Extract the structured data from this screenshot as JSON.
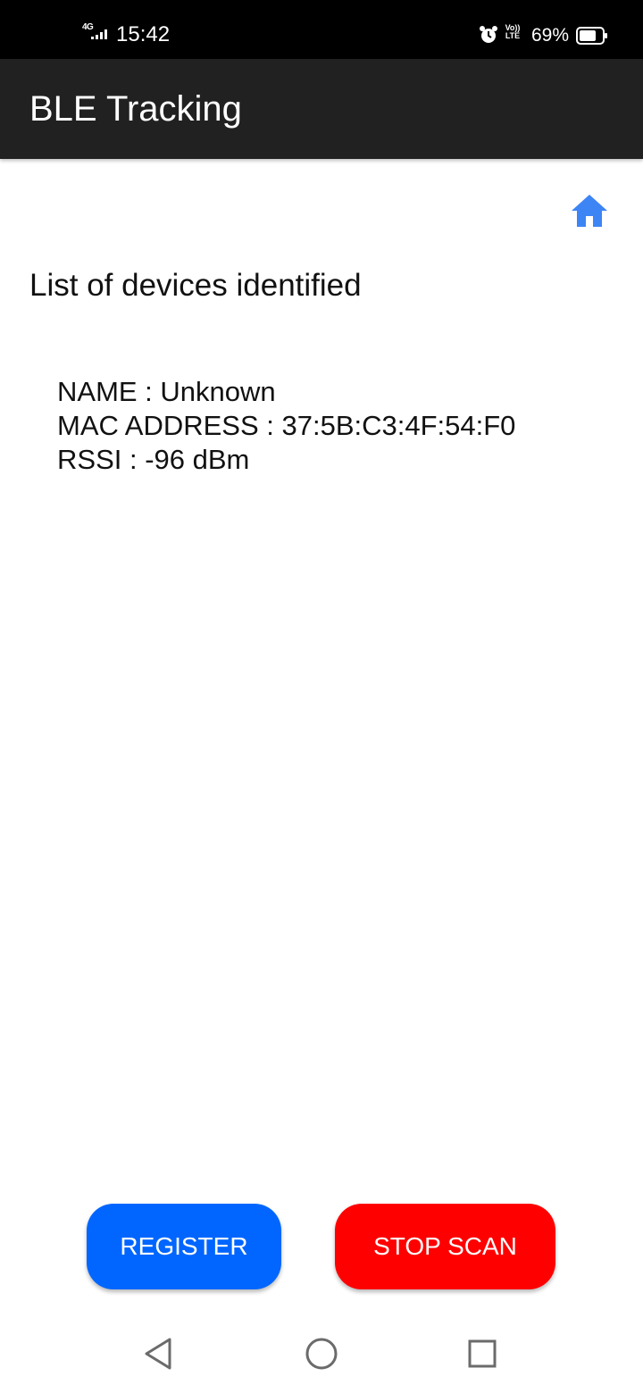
{
  "status_bar": {
    "network_type": "4G",
    "time": "15:42",
    "volte_top": "Vo))",
    "volte_bottom": "LTE",
    "battery_percent": "69%",
    "icons": [
      "signal-icon",
      "alarm-icon",
      "volte-icon",
      "battery-icon"
    ]
  },
  "app_bar": {
    "title": "BLE Tracking"
  },
  "main": {
    "home_icon": "home-icon",
    "section_title": "List of devices identified",
    "devices": [
      {
        "name_line": "NAME : Unknown",
        "mac_line": "MAC ADDRESS : 37:5B:C3:4F:54:F0",
        "rssi_line": "RSSI : -96 dBm"
      }
    ]
  },
  "actions": {
    "register_label": "REGISTER",
    "stop_scan_label": "STOP SCAN"
  },
  "nav_bar": {
    "icons": [
      "back-icon",
      "home-circle-icon",
      "recents-icon"
    ]
  },
  "colors": {
    "status_bar_bg": "#000000",
    "app_bar_bg": "#212121",
    "accent_blue": "#3d85f5",
    "register_button": "#0066ff",
    "stop_scan_button": "#ff0000"
  }
}
